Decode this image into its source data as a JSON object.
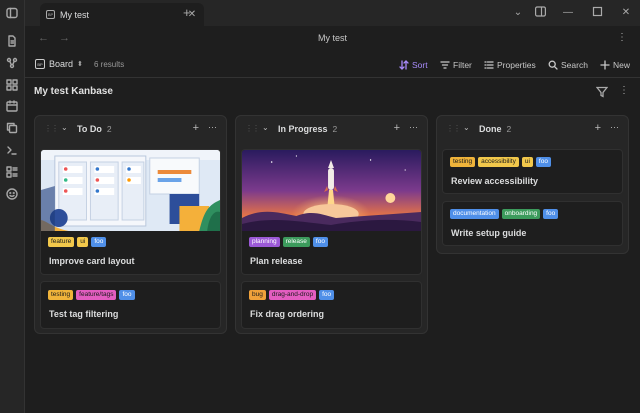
{
  "tab": {
    "title": "My test",
    "icon_text": "BP"
  },
  "nav": {
    "title": "My test"
  },
  "toolbar": {
    "view_label": "Board",
    "results": "6 results",
    "sort": "Sort",
    "filter": "Filter",
    "properties": "Properties",
    "search": "Search",
    "new": "New"
  },
  "kanban": {
    "title": "My test Kanbase"
  },
  "colors": {
    "accent": "#a88bfa",
    "tag_yellow": "#f2c84b",
    "tag_blue": "#4f8fe8",
    "tag_pink": "#e35dc0",
    "tag_orange": "#f0a13a",
    "tag_purple": "#9b59d6",
    "tag_green": "#3c9b5c"
  },
  "columns": [
    {
      "name": "To Do",
      "count": "2",
      "cards": [
        {
          "title": "Improve card layout",
          "tags": [
            {
              "label": "feature",
              "color": "#f2c84b"
            },
            {
              "label": "ui",
              "color": "#f2c84b"
            },
            {
              "label": "foo",
              "color": "#4f8fe8"
            }
          ],
          "image": "ui-illustration"
        },
        {
          "title": "Test tag filtering",
          "tags": [
            {
              "label": "testing",
              "color": "#f0b43a"
            },
            {
              "label": "feature/tags",
              "color": "#e35dc0"
            },
            {
              "label": "foo",
              "color": "#4f8fe8"
            }
          ]
        }
      ]
    },
    {
      "name": "In Progress",
      "count": "2",
      "cards": [
        {
          "title": "Plan release",
          "tags": [
            {
              "label": "planning",
              "color": "#9b59d6"
            },
            {
              "label": "release",
              "color": "#3c9b5c"
            },
            {
              "label": "foo",
              "color": "#4f8fe8"
            }
          ],
          "image": "rocket-launch"
        },
        {
          "title": "Fix drag ordering",
          "tags": [
            {
              "label": "bug",
              "color": "#f0a13a"
            },
            {
              "label": "drag-and-drop",
              "color": "#e35dc0"
            },
            {
              "label": "foo",
              "color": "#4f8fe8"
            }
          ]
        }
      ]
    },
    {
      "name": "Done",
      "count": "2",
      "cards": [
        {
          "title": "Review accessibility",
          "tags": [
            {
              "label": "testing",
              "color": "#f0b43a"
            },
            {
              "label": "accessibility",
              "color": "#f2c84b"
            },
            {
              "label": "ui",
              "color": "#f2c84b"
            },
            {
              "label": "foo",
              "color": "#4f8fe8"
            }
          ]
        },
        {
          "title": "Write setup guide",
          "tags": [
            {
              "label": "documentation",
              "color": "#4f8fe8"
            },
            {
              "label": "onboarding",
              "color": "#3c9b5c"
            },
            {
              "label": "foo",
              "color": "#4f8fe8"
            }
          ]
        }
      ]
    }
  ]
}
